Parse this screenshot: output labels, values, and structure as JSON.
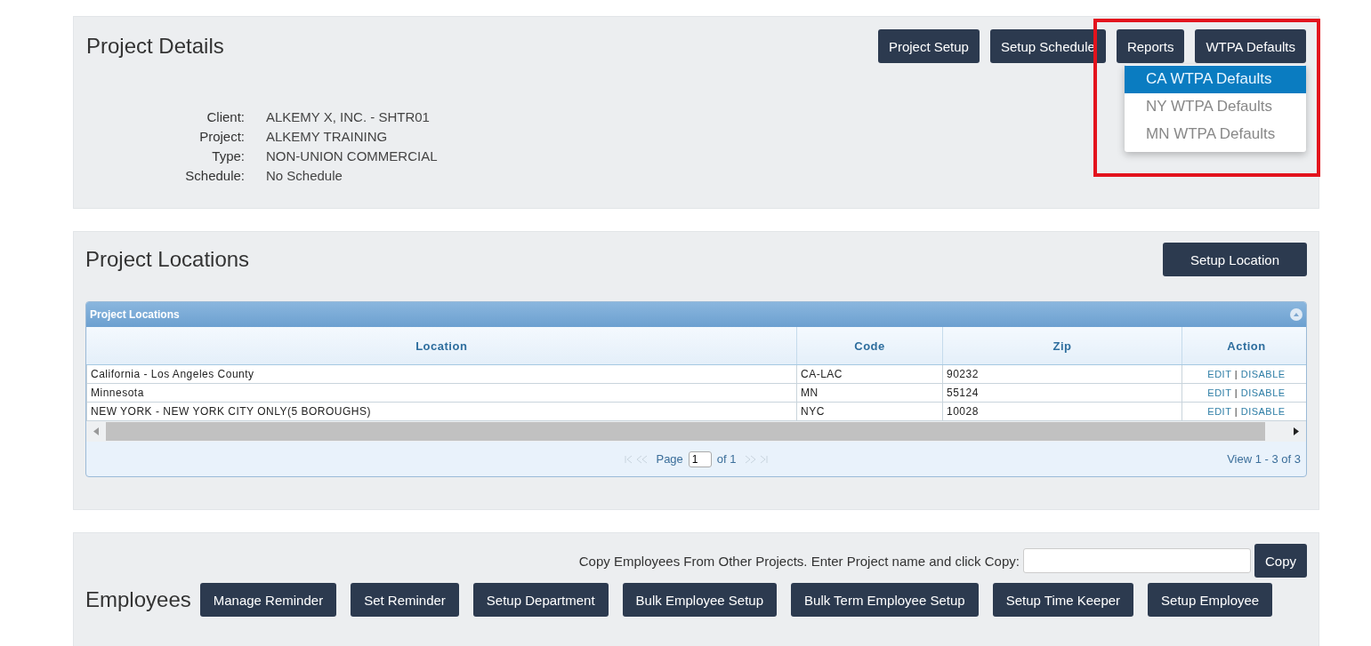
{
  "project_details": {
    "title": "Project Details",
    "buttons": [
      {
        "label": "Project Setup"
      },
      {
        "label": "Setup Schedule"
      },
      {
        "label": "Reports"
      },
      {
        "label": "WTPA Defaults",
        "menu": [
          {
            "label": "CA WTPA Defaults",
            "selected": true
          },
          {
            "label": "NY WTPA Defaults",
            "selected": false
          },
          {
            "label": "MN WTPA Defaults",
            "selected": false
          }
        ]
      }
    ],
    "fields": [
      {
        "label": "Client:",
        "value": "ALKEMY X, INC. - SHTR01"
      },
      {
        "label": "Project:",
        "value": "ALKEMY TRAINING"
      },
      {
        "label": "Type:",
        "value": "NON-UNION COMMERCIAL"
      },
      {
        "label": "Schedule:",
        "value": "No Schedule"
      }
    ]
  },
  "project_locations": {
    "title": "Project Locations",
    "button": "Setup Location",
    "grid": {
      "title": "Project Locations",
      "columns": [
        "Location",
        "Code",
        "Zip",
        "Action"
      ],
      "rows": [
        {
          "location": "California - Los Angeles County",
          "code": "CA-LAC",
          "zip": "90232",
          "actions": [
            "EDIT",
            "|",
            "DISABLE"
          ]
        },
        {
          "location": "Minnesota",
          "code": "MN",
          "zip": "55124",
          "actions": [
            "EDIT",
            "|",
            "DISABLE"
          ]
        },
        {
          "location": "NEW YORK - NEW YORK CITY ONLY(5 BOROUGHS)",
          "code": "NYC",
          "zip": "10028",
          "actions": [
            "EDIT",
            "|",
            "DISABLE"
          ]
        }
      ],
      "pager": {
        "page_label": "Page",
        "page_value": "1",
        "page_total": "of 1",
        "view": "View 1 - 3 of 3"
      }
    }
  },
  "employees": {
    "copy_prompt": "Copy Employees From Other Projects. Enter Project name and click Copy:",
    "copy_button": "Copy",
    "title": "Employees",
    "buttons": [
      "Manage Reminder",
      "Set Reminder",
      "Setup Department",
      "Bulk Employee Setup",
      "Bulk Term Employee Setup",
      "Setup Time Keeper",
      "Setup Employee"
    ]
  }
}
